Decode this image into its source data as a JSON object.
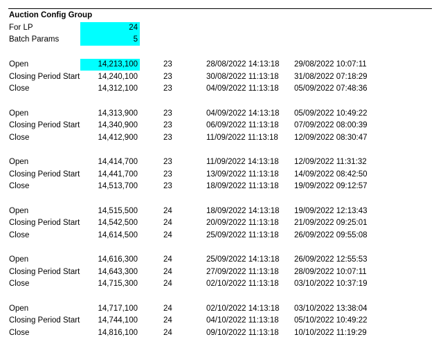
{
  "sheet": {
    "title": "Auction Config Group",
    "params": [
      {
        "label": "For LP",
        "value": "24"
      },
      {
        "label": "Batch Params",
        "value": "5"
      }
    ]
  },
  "groups": [
    {
      "rows": [
        {
          "label": "Open",
          "value": "14,213,100",
          "count": "23",
          "t1": "28/08/2022 14:13:18",
          "t2": "29/08/2022 10:07:11"
        },
        {
          "label": "Closing Period Start",
          "value": "14,240,100",
          "count": "23",
          "t1": "30/08/2022 11:13:18",
          "t2": "31/08/2022 07:18:29"
        },
        {
          "label": "Close",
          "value": "14,312,100",
          "count": "23",
          "t1": "04/09/2022 11:13:18",
          "t2": "05/09/2022 07:48:36"
        }
      ]
    },
    {
      "rows": [
        {
          "label": "Open",
          "value": "14,313,900",
          "count": "23",
          "t1": "04/09/2022 14:13:18",
          "t2": "05/09/2022 10:49:22"
        },
        {
          "label": "Closing Period Start",
          "value": "14,340,900",
          "count": "23",
          "t1": "06/09/2022 11:13:18",
          "t2": "07/09/2022 08:00:39"
        },
        {
          "label": "Close",
          "value": "14,412,900",
          "count": "23",
          "t1": "11/09/2022 11:13:18",
          "t2": "12/09/2022 08:30:47"
        }
      ]
    },
    {
      "rows": [
        {
          "label": "Open",
          "value": "14,414,700",
          "count": "23",
          "t1": "11/09/2022 14:13:18",
          "t2": "12/09/2022 11:31:32"
        },
        {
          "label": "Closing Period Start",
          "value": "14,441,700",
          "count": "23",
          "t1": "13/09/2022 11:13:18",
          "t2": "14/09/2022 08:42:50"
        },
        {
          "label": "Close",
          "value": "14,513,700",
          "count": "23",
          "t1": "18/09/2022 11:13:18",
          "t2": "19/09/2022 09:12:57"
        }
      ]
    },
    {
      "rows": [
        {
          "label": "Open",
          "value": "14,515,500",
          "count": "24",
          "t1": "18/09/2022 14:13:18",
          "t2": "19/09/2022 12:13:43"
        },
        {
          "label": "Closing Period Start",
          "value": "14,542,500",
          "count": "24",
          "t1": "20/09/2022 11:13:18",
          "t2": "21/09/2022 09:25:01"
        },
        {
          "label": "Close",
          "value": "14,614,500",
          "count": "24",
          "t1": "25/09/2022 11:13:18",
          "t2": "26/09/2022 09:55:08"
        }
      ]
    },
    {
      "rows": [
        {
          "label": "Open",
          "value": "14,616,300",
          "count": "24",
          "t1": "25/09/2022 14:13:18",
          "t2": "26/09/2022 12:55:53"
        },
        {
          "label": "Closing Period Start",
          "value": "14,643,300",
          "count": "24",
          "t1": "27/09/2022 11:13:18",
          "t2": "28/09/2022 10:07:11"
        },
        {
          "label": "Close",
          "value": "14,715,300",
          "count": "24",
          "t1": "02/10/2022 11:13:18",
          "t2": "03/10/2022 10:37:19"
        }
      ]
    },
    {
      "rows": [
        {
          "label": "Open",
          "value": "14,717,100",
          "count": "24",
          "t1": "02/10/2022 14:13:18",
          "t2": "03/10/2022 13:38:04"
        },
        {
          "label": "Closing Period Start",
          "value": "14,744,100",
          "count": "24",
          "t1": "04/10/2022 11:13:18",
          "t2": "05/10/2022 10:49:22"
        },
        {
          "label": "Close",
          "value": "14,816,100",
          "count": "24",
          "t1": "09/10/2022 11:13:18",
          "t2": "10/10/2022 11:19:29"
        }
      ]
    }
  ]
}
